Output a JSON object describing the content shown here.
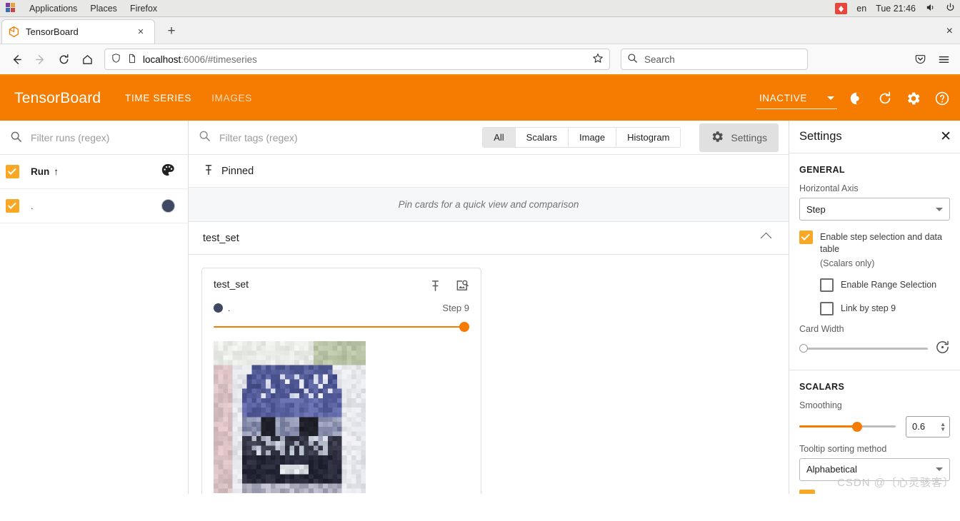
{
  "os_bar": {
    "menus": [
      "Applications",
      "Places",
      "Firefox"
    ],
    "keyboard_layout": "en",
    "clock": "Tue 21:46",
    "icons": [
      "input-method-icon",
      "volume-icon",
      "power-icon"
    ]
  },
  "browser": {
    "tab_title": "TensorBoard",
    "new_tab_label": "+",
    "close_tab_label": "×",
    "window_close_label": "×",
    "url_host": "localhost",
    "url_rest": ":6006/#timeseries",
    "search_placeholder": "Search",
    "nav_icons": [
      "back-icon",
      "forward-icon",
      "reload-icon",
      "home-icon",
      "shield-icon",
      "page-icon",
      "bookmark-star-icon",
      "pocket-icon",
      "menu-icon"
    ]
  },
  "tensorboard": {
    "brand": "TensorBoard",
    "tabs": [
      {
        "label": "TIME SERIES",
        "active": true
      },
      {
        "label": "IMAGES",
        "active": false
      }
    ],
    "status": "INACTIVE",
    "header_icons": [
      "dark-mode-icon",
      "reload-icon",
      "settings-gear-icon",
      "help-icon"
    ],
    "accent_color": "#f57c00"
  },
  "runs_panel": {
    "filter_placeholder": "Filter runs (regex)",
    "column_header": "Run",
    "sort_arrow": "↑",
    "palette_icon": "color-palette-icon",
    "rows": [
      {
        "name": ".",
        "checked": true,
        "color": "#3f4a62"
      }
    ]
  },
  "main": {
    "tag_filter_placeholder": "Filter tags (regex)",
    "plugin_filters": [
      {
        "label": "All",
        "selected": true
      },
      {
        "label": "Scalars",
        "selected": false
      },
      {
        "label": "Image",
        "selected": false
      },
      {
        "label": "Histogram",
        "selected": false
      }
    ],
    "settings_button_label": "Settings",
    "pinned_header": "Pinned",
    "pinned_empty_text": "Pin cards for a quick view and comparison",
    "group_name": "test_set",
    "card": {
      "title": "test_set",
      "run_label": ".",
      "run_color": "#3f4a62",
      "step_label": "Step 9",
      "slider_value": 100,
      "icons": [
        "pin-icon",
        "image-zoom-icon"
      ]
    }
  },
  "settings_panel": {
    "title": "Settings",
    "close_label": "✕",
    "general_section": "GENERAL",
    "horizontal_axis_label": "Horizontal Axis",
    "horizontal_axis_value": "Step",
    "step_selection_label": "Enable step selection and data table",
    "step_selection_checked": true,
    "scalars_only_note": "(Scalars only)",
    "range_selection_label": "Enable Range Selection",
    "range_selection_checked": false,
    "link_by_step_label": "Link by step 9",
    "link_by_step_checked": false,
    "card_width_label": "Card Width",
    "card_width_value": 0,
    "reset_icon": "reset-icon",
    "scalars_section": "SCALARS",
    "smoothing_label": "Smoothing",
    "smoothing_value": "0.6",
    "tooltip_sorting_label": "Tooltip sorting method",
    "tooltip_sorting_value": "Alphabetical"
  },
  "watermark": "CSDN @〔心灵骇客〕"
}
